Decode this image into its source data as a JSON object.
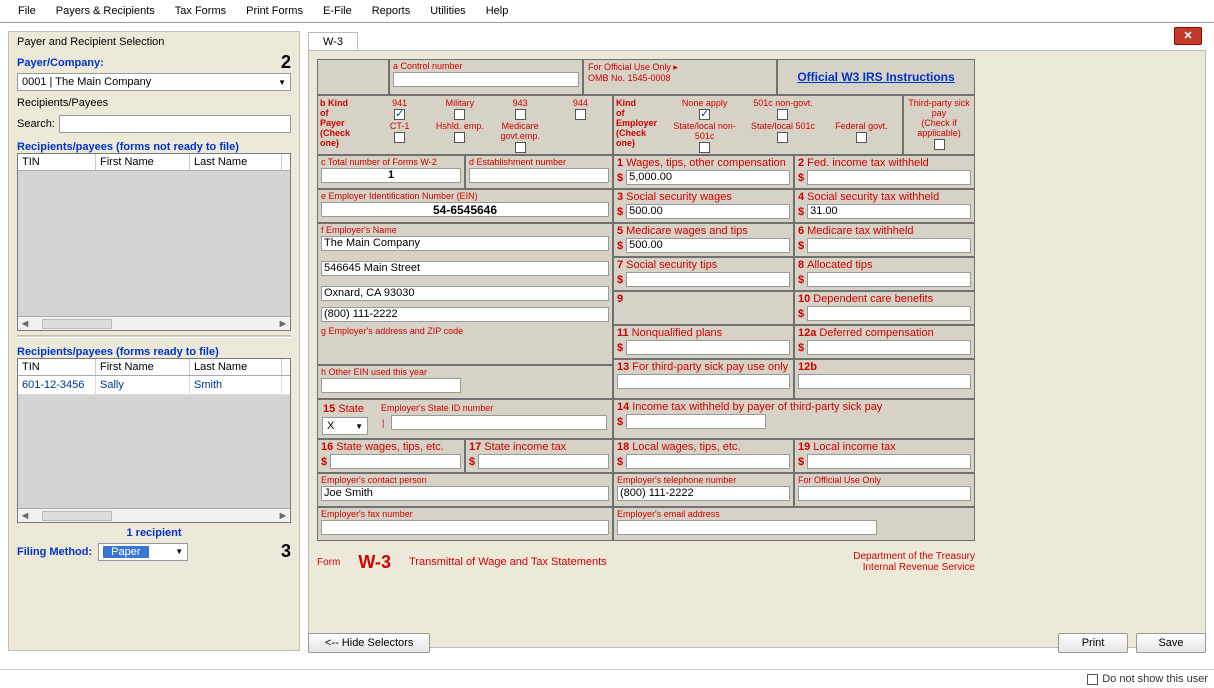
{
  "menu": [
    "File",
    "Payers & Recipients",
    "Tax Forms",
    "Print Forms",
    "E-File",
    "Reports",
    "Utilities",
    "Help"
  ],
  "selection": {
    "title": "Payer and Recipient Selection",
    "payer_label": "Payer/Company:",
    "step2": "2",
    "payer_value": "0001 | The Main Company",
    "rp_label": "Recipients/Payees",
    "search_label": "Search:",
    "not_ready_label": "Recipients/payees (forms not ready to file)",
    "ready_label": "Recipients/payees (forms ready to file)",
    "cols": {
      "tin": "TIN",
      "fn": "First Name",
      "ln": "Last Name"
    },
    "ready_rows": [
      {
        "tin": "601-12-3456",
        "fn": "Sally",
        "ln": "Smith"
      }
    ],
    "count": "1 recipient",
    "filing_label": "Filing Method:",
    "filing_value": "Paper",
    "step3": "3"
  },
  "tab": "W-3",
  "form": {
    "ctrl_num_label": "a   Control number",
    "off_use": "For Official Use Only ▸",
    "omb": "OMB No. 1545-0008",
    "instructions": "Official W3 IRS Instructions",
    "kind_payer_head": "b   Kind\nof\nPayer\n(Check one)",
    "payer_opts": [
      "941",
      "Military",
      "943",
      "944",
      "CT-1",
      "Hshld. emp.",
      "Medicare govt.emp."
    ],
    "payer_checked": 0,
    "kind_emp_head": "Kind\nof\nEmployer\n(Check one)",
    "emp_opts": [
      "None apply",
      "501c non-govt.",
      "State/local non-501c",
      "State/local 501c",
      "Federal govt."
    ],
    "emp_checked": 0,
    "thirdparty": "Third-party sick pay\n(Check if applicable)",
    "c_label": "c   Total number of Forms W-2",
    "c_val": "1",
    "d_label": "d   Establishment number",
    "d_val": "",
    "e_label": "e   Employer Identification Number (EIN)",
    "e_val": "54-6545646",
    "f_label": "f   Employer's Name",
    "f_val": "The Main Company",
    "addr1": "546645 Main Street",
    "addr2": "Oxnard, CA 93030",
    "phone": "(800) 111-2222",
    "g_label": "g   Employer's address and ZIP code",
    "h_label": "h   Other EIN used this year",
    "boxes": {
      "1": {
        "l": "Wages, tips, other compensation",
        "v": "5,000.00"
      },
      "2": {
        "l": "Fed. income tax withheld",
        "v": ""
      },
      "3": {
        "l": "Social security wages",
        "v": "500.00"
      },
      "4": {
        "l": "Social security tax withheld",
        "v": "31.00"
      },
      "5": {
        "l": "Medicare wages and tips",
        "v": "500.00"
      },
      "6": {
        "l": "Medicare tax withheld",
        "v": ""
      },
      "7": {
        "l": "Social security tips",
        "v": ""
      },
      "8": {
        "l": "Allocated tips",
        "v": ""
      },
      "9": {
        "l": "",
        "v": ""
      },
      "10": {
        "l": "Dependent care benefits",
        "v": ""
      },
      "11": {
        "l": "Nonqualified plans",
        "v": ""
      },
      "12a": {
        "l": "Deferred compensation",
        "v": ""
      },
      "12b": {
        "l": "",
        "v": ""
      },
      "13": {
        "l": "For third-party sick pay use only",
        "v": ""
      },
      "14": {
        "l": "Income tax withheld by payer of third-party sick pay",
        "v": ""
      },
      "15": {
        "l": "State"
      },
      "15v": "X",
      "state_id_label": "Employer's State ID number",
      "state_id_val": "",
      "16": {
        "l": "State wages, tips, etc.",
        "v": ""
      },
      "17": {
        "l": "State income tax",
        "v": ""
      },
      "18": {
        "l": "Local wages, tips, etc.",
        "v": ""
      },
      "19": {
        "l": "Local income tax",
        "v": ""
      }
    },
    "contact_label": "Employer's contact person",
    "contact_val": "Joe Smith",
    "tel_label": "Employer's telephone number",
    "tel_val": "(800) 111-2222",
    "off_use2": "For Official Use Only",
    "fax_label": "Employer's fax number",
    "email_label": "Employer's email address",
    "footer_form": "Form",
    "footer_w3": "W-3",
    "footer_title": "Transmittal of Wage and Tax Statements",
    "footer_dept": "Department of the Treasury\nInternal Revenue Service"
  },
  "buttons": {
    "hide": "<-- Hide Selectors",
    "print": "Print",
    "save": "Save"
  },
  "status": "Do not show this user"
}
